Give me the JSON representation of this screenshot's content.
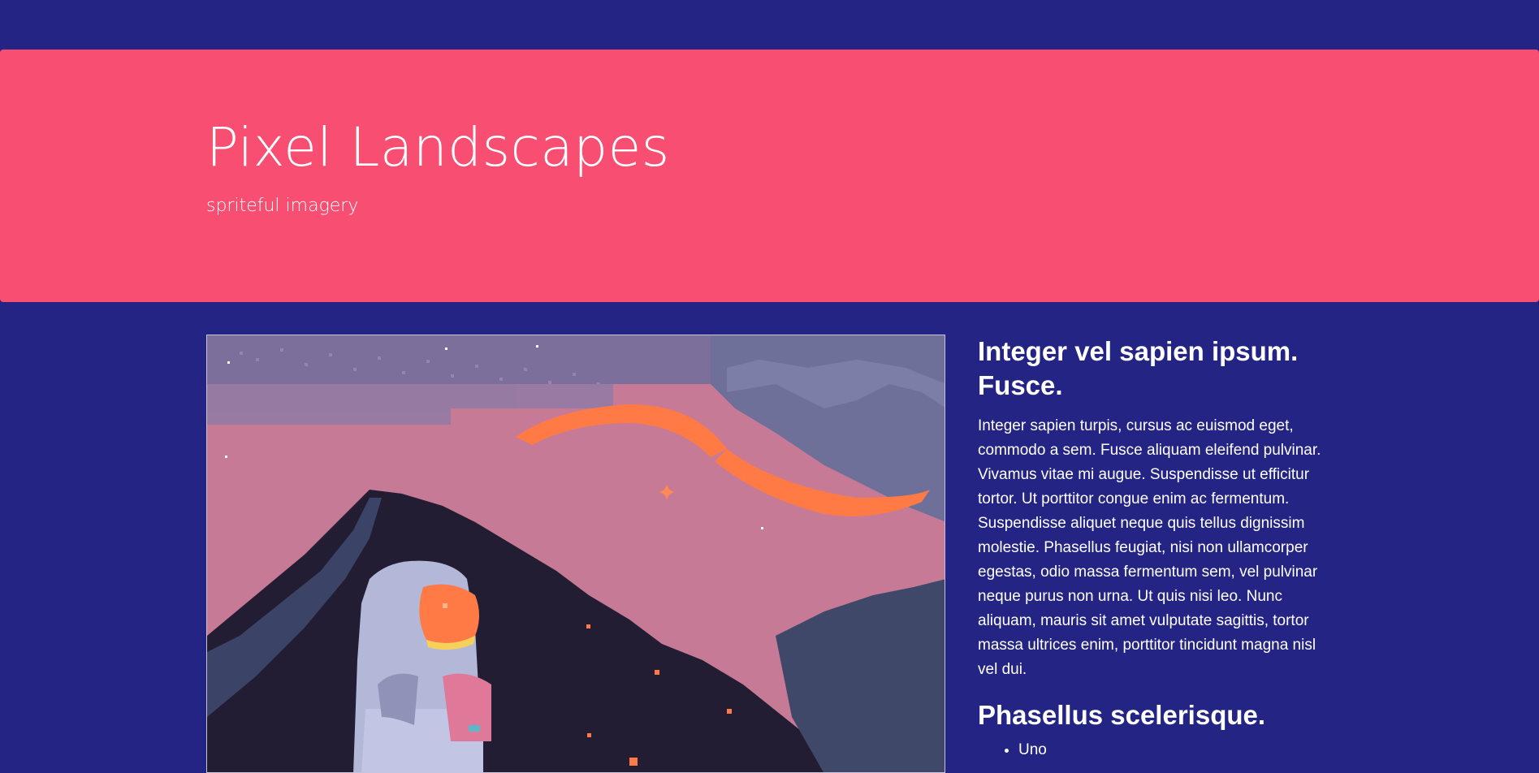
{
  "colors": {
    "page_background": "#242485",
    "hero_background": "#f74e72",
    "text": "#ffffff"
  },
  "hero": {
    "title": "Pixel Landscapes",
    "subtitle": "spriteful imagery"
  },
  "image": {
    "subject": "pixel-art astronaut sitting on a mountain under a pink sky with a ringed planet"
  },
  "sidebar": {
    "heading_1": "Integer vel sapien ipsum. Fusce.",
    "paragraph": "Integer sapien turpis, cursus ac euismod eget, commodo a sem. Fusce aliquam eleifend pulvinar. Vivamus vitae mi augue. Suspendisse ut efficitur tortor. Ut porttitor congue enim ac fermentum. Suspendisse aliquet neque quis tellus dignissim molestie. Phasellus feugiat, nisi non ullamcorper egestas, odio massa fermentum sem, vel pulvinar neque purus non urna. Ut quis nisi leo. Nunc aliquam, mauris sit amet vulputate sagittis, tortor massa ultrices enim, porttitor tincidunt magna nisl vel dui.",
    "heading_2": "Phasellus scelerisque.",
    "list": [
      {
        "label": "Uno"
      }
    ]
  }
}
